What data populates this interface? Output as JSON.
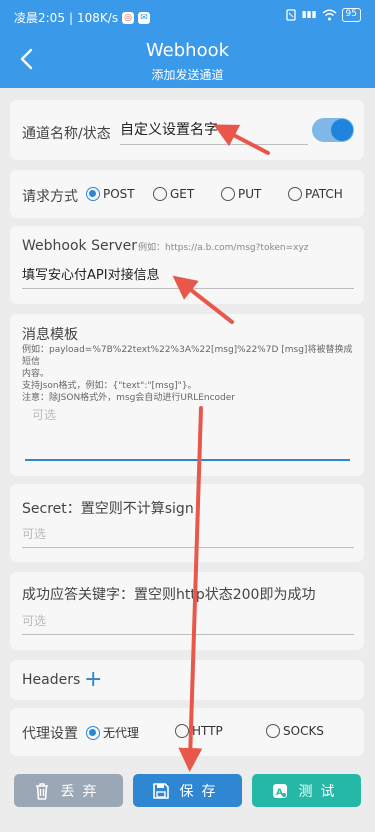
{
  "status_bar": {
    "time": "凌晨2:05",
    "speed": "108K/s",
    "badge1": "◎",
    "badge2": "✉",
    "signal": "▮▮▮",
    "battery": "95"
  },
  "header": {
    "title": "Webhook",
    "subtitle": "添加发送通道"
  },
  "channel": {
    "label": "通道名称/状态",
    "value": "自定义设置名字",
    "enabled": true
  },
  "request": {
    "label": "请求方式",
    "options": [
      "POST",
      "GET",
      "PUT",
      "PATCH"
    ],
    "selected": "POST"
  },
  "server": {
    "label": "Webhook Server",
    "example": "例如：https://a.b.com/msg?token=xyz",
    "value": "填写安心付API对接信息"
  },
  "template": {
    "label": "消息模板",
    "hint_lines": [
      "例如：payload=%7B%22text%22%3A%22[msg]%22%7D [msg]将被替换成短信",
      "内容。",
      "支持Json格式，例如：{\"text\":\"[msg]\"}。",
      "注意：除JSON格式外，msg会自动进行URLEncoder"
    ],
    "placeholder": "可选"
  },
  "secret": {
    "label": "Secret：置空则不计算sign",
    "placeholder": "可选"
  },
  "success_keyword": {
    "label": "成功应答关键字：置空则http状态200即为成功",
    "placeholder": "可选"
  },
  "headers": {
    "label": "Headers",
    "add_icon": "+"
  },
  "proxy": {
    "label": "代理设置",
    "options": [
      "无代理",
      "HTTP",
      "SOCKS"
    ],
    "selected": "无代理"
  },
  "buttons": {
    "discard": "丢弃",
    "save": "保存",
    "test": "测试"
  },
  "colors": {
    "header": "#3a99e8",
    "accent": "#2b86d6",
    "discard": "#9aa7b4",
    "save": "#2f86d3",
    "test": "#26b8a6",
    "annotation": "#e8574a"
  }
}
